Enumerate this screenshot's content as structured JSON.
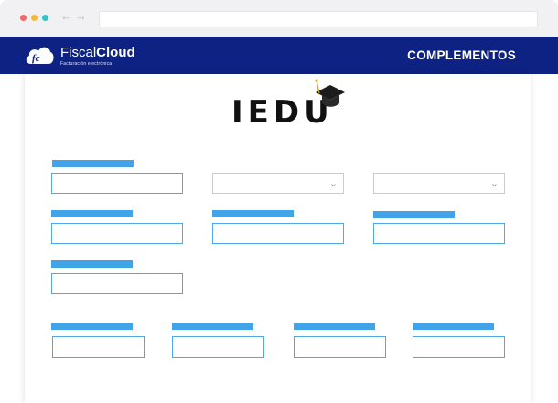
{
  "browser": {
    "back_arrow": "←",
    "forward_arrow": "→",
    "url": ""
  },
  "header": {
    "logo_prefix": "Fiscal",
    "logo_suffix": "Cloud",
    "logo_tagline": "Facturación electrónica",
    "nav_link": "COMPLEMENTOS"
  },
  "content": {
    "brand_title": "IEDU",
    "chevron_glyph": "⌄"
  },
  "colors": {
    "header_bg": "#0e2283",
    "label_bar": "#41a4e8",
    "input_border": "#4ea8ea",
    "select_border": "#c9ccd2"
  }
}
